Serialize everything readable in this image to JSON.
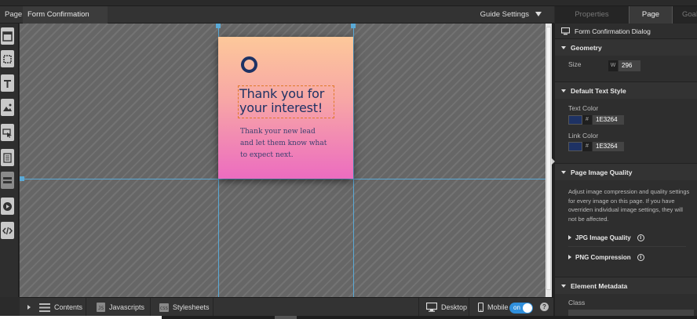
{
  "tabs": {
    "page": "Page",
    "active_doc": "Form Confirmation Dialog"
  },
  "guide_settings": {
    "label": "Guide Settings"
  },
  "canvas": {
    "card": {
      "headline": "Thank you for your interest!",
      "body": "Thank your new lead and let them know what to expect next."
    }
  },
  "bottom_bar": {
    "contents": "Contents",
    "javascripts": "Javascripts",
    "stylesheets": "Stylesheets",
    "desktop": "Desktop",
    "mobile": "Mobile",
    "mobile_toggle": "on",
    "help": "?"
  },
  "right_panel": {
    "tabs": {
      "properties": "Properties",
      "page_properties": "Page Properties",
      "goals": "Goals"
    },
    "page_title": "Form Confirmation Dialog",
    "geometry": {
      "header": "Geometry",
      "size_label": "Size",
      "width_prefix": "W",
      "width_value": "296"
    },
    "text_style": {
      "header": "Default Text Style",
      "text_color_label": "Text Color",
      "text_color_hex": "1E3264",
      "link_color_label": "Link Color",
      "link_color_hex": "1E3264",
      "hash": "#"
    },
    "image_quality": {
      "header": "Page Image Quality",
      "description": "Adjust image compression and quality settings for every image on this page. If you have overriden individual image settings, they will not be affected.",
      "jpg_label": "JPG Image Quality",
      "png_label": "PNG Compression"
    },
    "metadata": {
      "header": "Element Metadata",
      "class_label": "Class"
    }
  },
  "colors": {
    "text_color": "#1E3264",
    "accent_toggle": "#2F8FDC",
    "guide_line": "#5AA9D6"
  }
}
